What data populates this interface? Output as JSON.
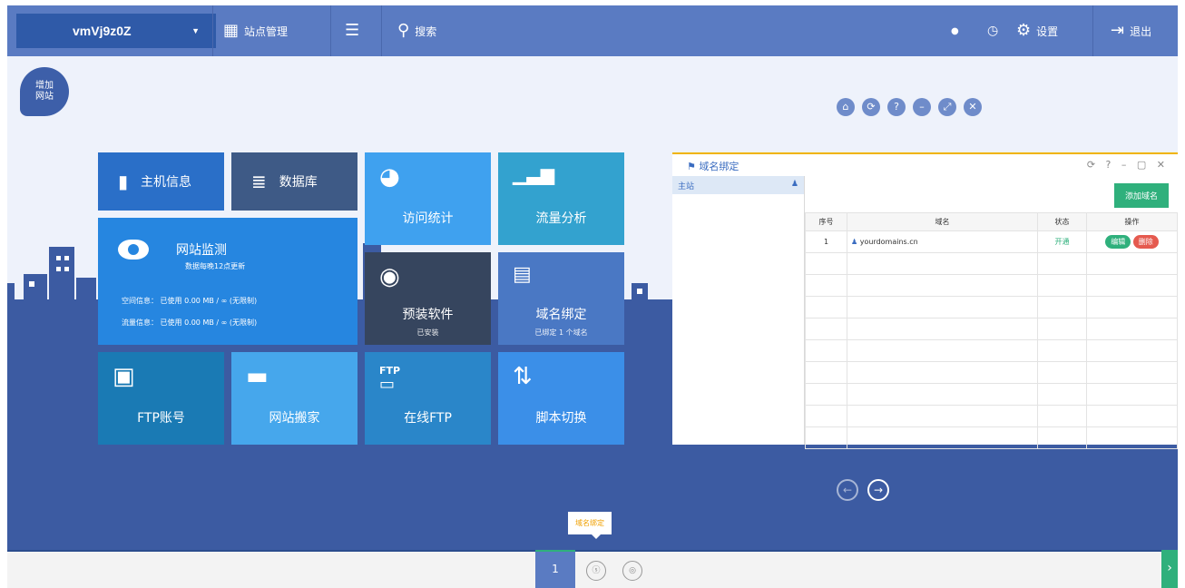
{
  "topbar": {
    "host": "vmVj9z0Z",
    "site_manage": "站点管理",
    "search": "搜索",
    "settings": "设置",
    "logout": "退出"
  },
  "desk": {
    "add_site_1": "增加",
    "add_site_2": "网站",
    "window_dots": [
      "⌂",
      "⟳",
      "?",
      "–",
      "⤢",
      "✕"
    ]
  },
  "tiles": {
    "host_info": "主机信息",
    "database": "数据库",
    "visit_stats": "访问统计",
    "traffic": "流量分析",
    "monitor": {
      "title": "网站监测",
      "sub": "数据每晚12点更新",
      "space": "空间信息： 已使用 0.00 MB / ∞ (无限制)",
      "flow": "流量信息： 已使用 0.00 MB / ∞ (无限制)"
    },
    "software": {
      "label": "预装软件",
      "sub": "已安装"
    },
    "binding": {
      "label": "域名绑定",
      "sub": "已绑定 1 个域名"
    },
    "ftp_account": "FTP账号",
    "migrate": "网站搬家",
    "online_ftp": {
      "icon_text": "FTP",
      "label": "在线FTP"
    },
    "script_switch": "脚本切换"
  },
  "domain_window": {
    "title": "域名绑定",
    "controls": "⟳ ? – ▢ ✕",
    "side_item": "主站",
    "add_button": "添加域名",
    "columns": [
      "序号",
      "域名",
      "状态",
      "操作"
    ],
    "rows": [
      {
        "no": "1",
        "domain": "yourdomains.cn",
        "status": "开通",
        "edit": "编辑",
        "delete": "删除"
      }
    ]
  },
  "tooltip": "域名绑定",
  "taskbar": {
    "active": "1",
    "item2": "ⓢ",
    "item3": "◎",
    "next": "›"
  },
  "colors": {
    "topbar": "#5a7bc2",
    "band": "#3c5ba2",
    "green": "#2fb07c",
    "red": "#e55a4f",
    "accent": "#f0b400"
  }
}
